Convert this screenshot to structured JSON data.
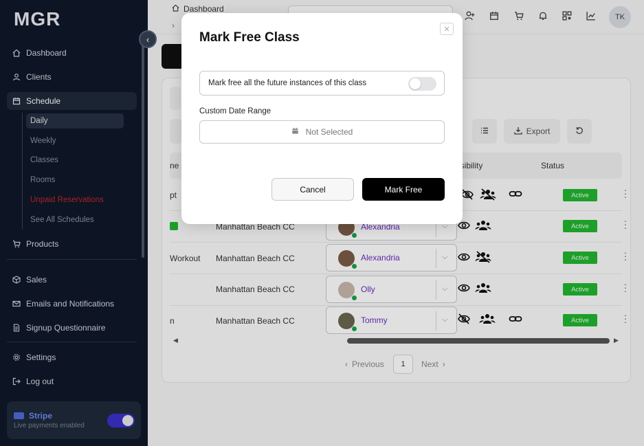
{
  "app": {
    "logo": "MGR"
  },
  "sidebar": {
    "items": [
      {
        "label": "Dashboard",
        "icon": "home-icon"
      },
      {
        "label": "Clients",
        "icon": "user-icon"
      },
      {
        "label": "Schedule",
        "icon": "calendar-icon"
      },
      {
        "label": "Products",
        "icon": "cart-icon"
      },
      {
        "label": "Sales",
        "icon": "box-icon"
      },
      {
        "label": "Emails and Notifications",
        "icon": "mail-icon"
      },
      {
        "label": "Signup Questionnaire",
        "icon": "document-icon"
      },
      {
        "label": "Settings",
        "icon": "gear-icon"
      },
      {
        "label": "Log out",
        "icon": "logout-icon"
      }
    ],
    "schedule_sub": [
      "Daily",
      "Weekly",
      "Classes",
      "Rooms",
      "Unpaid Reservations",
      "See All Schedules"
    ],
    "stripe": {
      "title": "Stripe",
      "subtitle": "Live payments enabled"
    }
  },
  "topbar": {
    "breadcrumb": "Dashboard",
    "breadcrumb_sub": "›",
    "avatar": "TK"
  },
  "toolbar": {
    "export": "Export"
  },
  "table": {
    "headers": {
      "name": "ne",
      "visibility": "isibility",
      "status": "Status"
    },
    "rows": [
      {
        "name": "pt",
        "location": "",
        "instructor": "",
        "status": "Active"
      },
      {
        "name": "",
        "location": "Manhattan Beach CC",
        "instructor": "Alexandria",
        "status": "Active"
      },
      {
        "name": "Workout",
        "location": "Manhattan Beach CC",
        "instructor": "Alexandria",
        "status": "Active"
      },
      {
        "name": "",
        "location": "Manhattan Beach CC",
        "instructor": "Olly",
        "status": "Active"
      },
      {
        "name": "n",
        "location": "Manhattan Beach CC",
        "instructor": "Tommy",
        "status": "Active"
      }
    ]
  },
  "pagination": {
    "previous": "Previous",
    "page": "1",
    "next": "Next"
  },
  "modal": {
    "title": "Mark Free Class",
    "close": "✕",
    "future_label": "Mark free all the future instances of this class",
    "range_label": "Custom Date Range",
    "range_value": "Not Selected",
    "cancel": "Cancel",
    "confirm": "Mark Free"
  },
  "colors": {
    "sidebar_bg": "#0f172a",
    "active_badge": "#22b530",
    "instructor_link": "#6a2fc1",
    "stripe_accent": "#3b30c9"
  }
}
